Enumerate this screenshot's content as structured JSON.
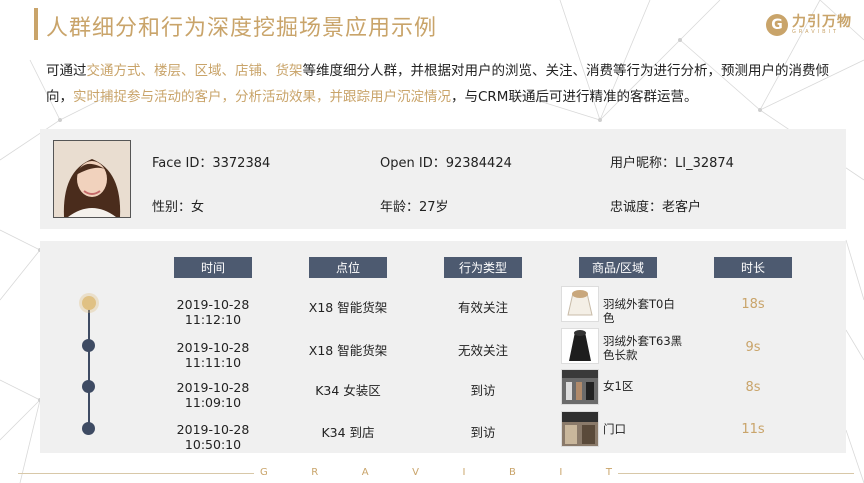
{
  "title": "人群细分和行为深度挖掘场景应用示例",
  "logo": {
    "mark": "G",
    "cn": "力引万物",
    "en": "GRAVIBIT"
  },
  "intro": [
    {
      "t": "可通过",
      "hl": false
    },
    {
      "t": "交通方式、楼层、区域、店铺、货架",
      "hl": true
    },
    {
      "t": "等维度细分人群，并根据对用户的浏览、关注、消费等行为进行分析，预测用户的消费倾向，",
      "hl": false
    },
    {
      "t": "实时捕捉参与活动的客户，分析活动效果，并跟踪用户沉淀情况",
      "hl": true
    },
    {
      "t": "，与CRM联通后可进行精准的客群运营。",
      "hl": false
    }
  ],
  "profile": {
    "face_id": "Face ID：3372384",
    "open_id": "Open ID：92384424",
    "nickname": "用户昵称：LI_32874",
    "gender": "性别：女",
    "age": "年龄：27岁",
    "loyalty": "忠诚度：老客户"
  },
  "table": {
    "headers": [
      "时间",
      "点位",
      "行为类型",
      "商品/区域",
      "时长"
    ],
    "rows": [
      {
        "time": "2019-10-28 11:12:10",
        "location": "X18 智能货架",
        "behavior": "有效关注",
        "item": "羽绒外套T0白色",
        "duration": "18s",
        "thumb": "white-jacket"
      },
      {
        "time": "2019-10-28 11:11:10",
        "location": "X18 智能货架",
        "behavior": "无效关注",
        "item": "羽绒外套T63黑色长款",
        "duration": "9s",
        "thumb": "black-coat"
      },
      {
        "time": "2019-10-28 11:09:10",
        "location": "K34 女装区",
        "behavior": "到访",
        "item": "女1区",
        "duration": "8s",
        "thumb": "store-interior"
      },
      {
        "time": "2019-10-28 10:50:10",
        "location": "K34 到店",
        "behavior": "到访",
        "item": "门口",
        "duration": "11s",
        "thumb": "store-front"
      }
    ]
  },
  "footer": [
    "G",
    "R",
    "A",
    "V",
    "I",
    "B",
    "I",
    "T"
  ],
  "colors": {
    "accent": "#c9a46a",
    "header": "#4d5a70",
    "timeline": "#3e4b63",
    "panel": "#f0f0f0"
  }
}
